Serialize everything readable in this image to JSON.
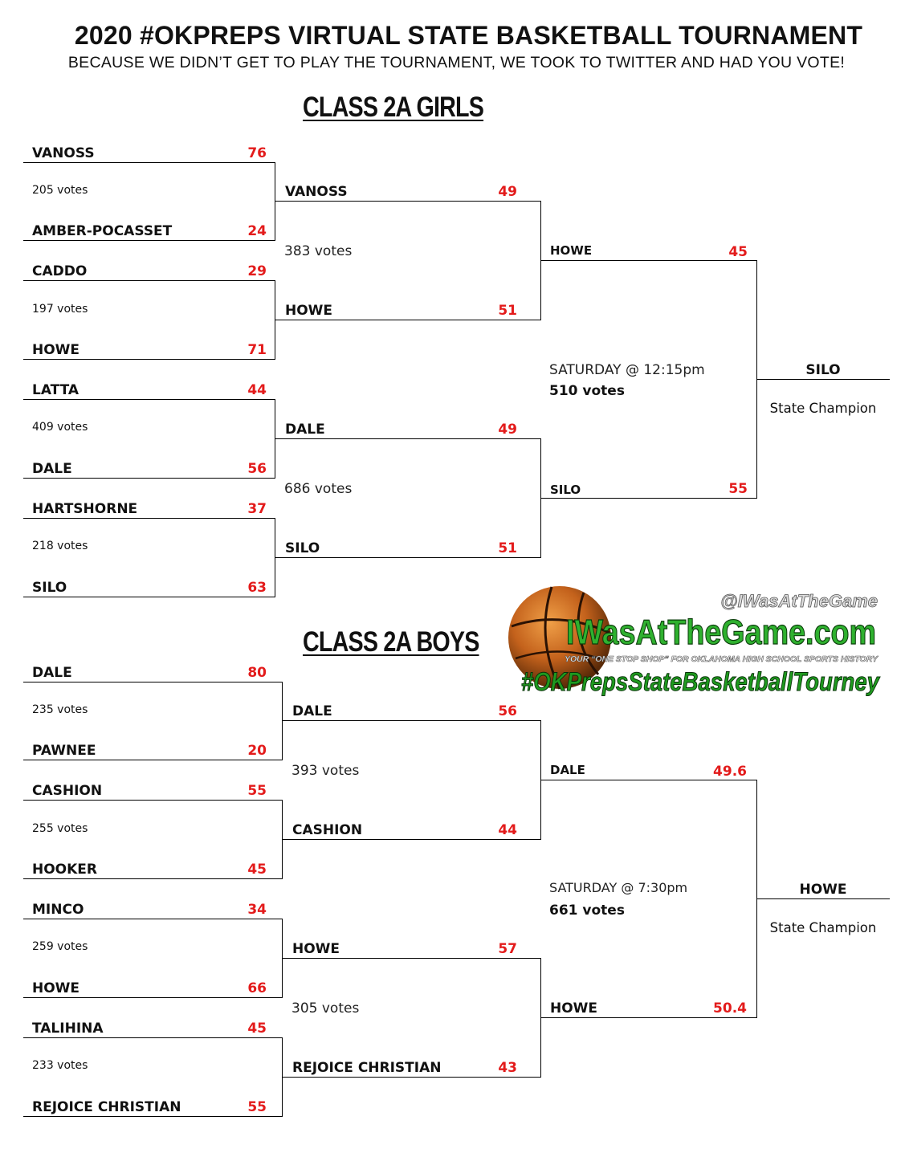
{
  "header": {
    "title": "2020 #OKPREPS VIRTUAL STATE  BASKETBALL TOURNAMENT",
    "subtitle": "BECAUSE WE DIDN’T GET TO PLAY THE TOURNAMENT, WE TOOK TO TWITTER AND HAD YOU VOTE!"
  },
  "girls": {
    "heading": "CLASS 2A GIRLS",
    "round1": [
      {
        "top": {
          "team": "VANOSS",
          "score": "76"
        },
        "votes": "205 votes",
        "bottom": {
          "team": "AMBER-POCASSET",
          "score": "24"
        }
      },
      {
        "top": {
          "team": "CADDO",
          "score": "29"
        },
        "votes": "197 votes",
        "bottom": {
          "team": "HOWE",
          "score": "71"
        }
      },
      {
        "top": {
          "team": "LATTA",
          "score": "44"
        },
        "votes": "409 votes",
        "bottom": {
          "team": "DALE",
          "score": "56"
        }
      },
      {
        "top": {
          "team": "HARTSHORNE",
          "score": "37"
        },
        "votes": "218 votes",
        "bottom": {
          "team": "SILO",
          "score": "63"
        }
      }
    ],
    "round2": [
      {
        "top": {
          "team": "VANOSS",
          "score": "49"
        },
        "votes": "383 votes",
        "bottom": {
          "team": "HOWE",
          "score": "51"
        }
      },
      {
        "top": {
          "team": "DALE",
          "score": "49"
        },
        "votes": "686 votes",
        "bottom": {
          "team": "SILO",
          "score": "51"
        }
      }
    ],
    "final": {
      "top": {
        "team": "HOWE",
        "score": "45"
      },
      "time": "SATURDAY @ 12:15pm",
      "votes": "510 votes",
      "bottom": {
        "team": "SILO",
        "score": "55"
      }
    },
    "champion": {
      "team": "SILO",
      "label": "State Champion"
    }
  },
  "boys": {
    "heading": "CLASS 2A BOYS",
    "round1": [
      {
        "top": {
          "team": "DALE",
          "score": "80"
        },
        "votes": "235 votes",
        "bottom": {
          "team": "PAWNEE",
          "score": "20"
        }
      },
      {
        "top": {
          "team": "CASHION",
          "score": "55"
        },
        "votes": "255 votes",
        "bottom": {
          "team": "HOOKER",
          "score": "45"
        }
      },
      {
        "top": {
          "team": "MINCO",
          "score": "34"
        },
        "votes": "259 votes",
        "bottom": {
          "team": "HOWE",
          "score": "66"
        }
      },
      {
        "top": {
          "team": "TALIHINA",
          "score": "45"
        },
        "votes": "233 votes",
        "bottom": {
          "team": "REJOICE CHRISTIAN",
          "score": "55"
        }
      }
    ],
    "round2": [
      {
        "top": {
          "team": "DALE",
          "score": "56"
        },
        "votes": "393 votes",
        "bottom": {
          "team": "CASHION",
          "score": "44"
        }
      },
      {
        "top": {
          "team": "HOWE",
          "score": "57"
        },
        "votes": "305 votes",
        "bottom": {
          "team": "REJOICE CHRISTIAN",
          "score": "43"
        }
      }
    ],
    "final": {
      "top": {
        "team": "DALE",
        "score": "49.6"
      },
      "time": "SATURDAY @ 7:30pm",
      "votes": "661 votes",
      "bottom": {
        "team": "HOWE",
        "score": "50.4"
      }
    },
    "champion": {
      "team": "HOWE",
      "label": "State Champion"
    }
  },
  "logo": {
    "handle": "@IWasAtTheGame",
    "site": "IWasAtTheGame.com",
    "tagline": "YOUR “ONE STOP SHOP” FOR OKLAHOMA HIGH SCHOOL SPORTS HISTORY",
    "hashtag": "#OKPrepsStateBasketballTourney"
  },
  "colors": {
    "score": "#e31b1b",
    "line": "#000000",
    "logo_green": "#1f8a1f",
    "ball_orange": "#d2691e"
  }
}
